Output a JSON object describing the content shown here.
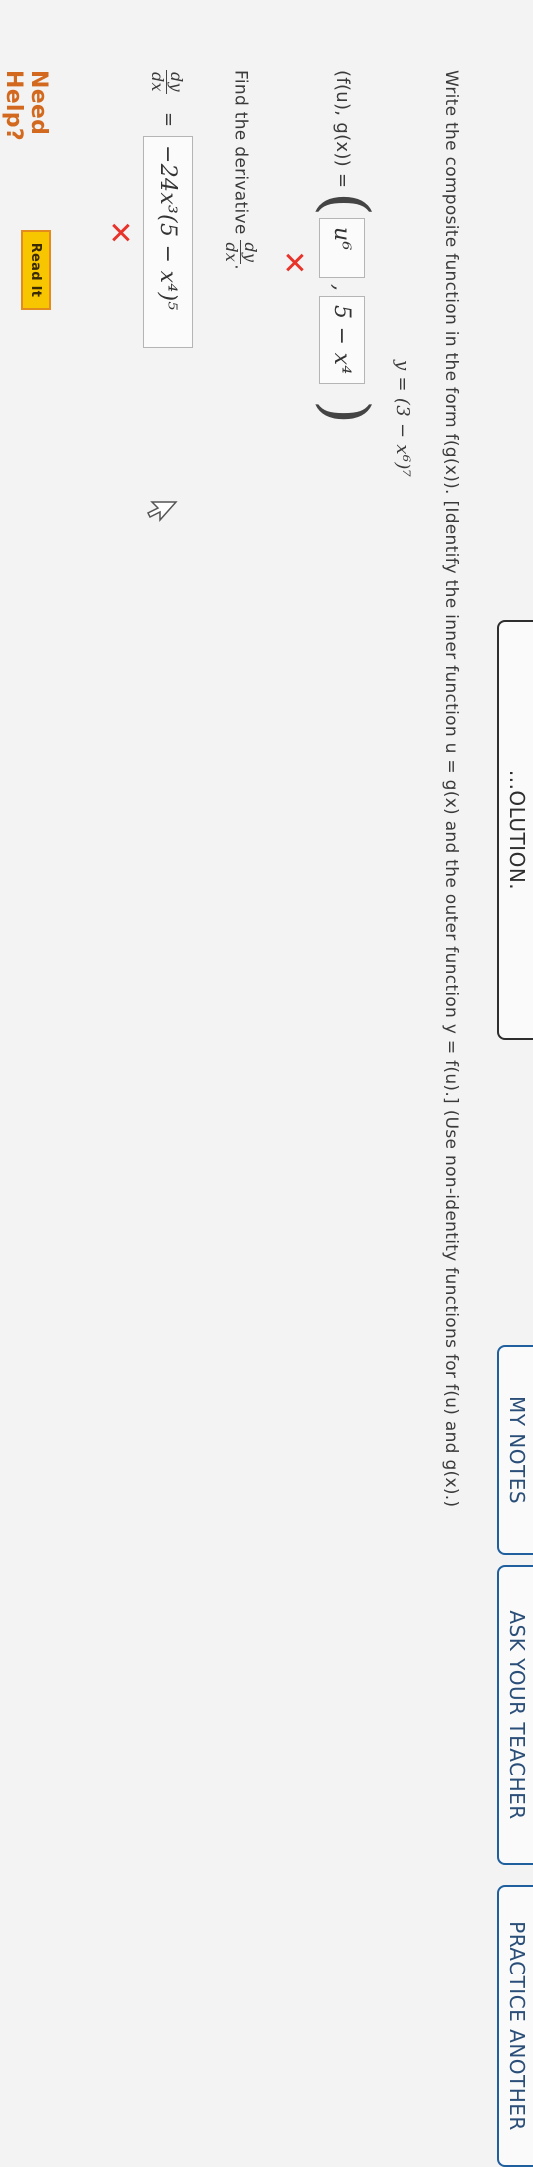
{
  "header": {
    "partial_title": "...OLUTION.",
    "my_notes_label": "MY NOTES",
    "ask_teacher_label": "ASK YOUR TEACHER",
    "practice_another_label": "PRACTICE ANOTHER"
  },
  "question": {
    "instruction": "Write the composite function in the form f(g(x)). [Identify the inner function u = g(x) and the outer function y = f(u).] (Use non-identity functions for f(u) and g(x).)",
    "function_expr": "y = (3 − x⁶)⁷",
    "pair_label": "(f(u), g(x)) =",
    "answer_fu": "u⁶",
    "answer_gx": "5 − x⁴",
    "answer_separator": ",",
    "derivative_prompt": "Find the derivative",
    "derivative_num": "dy",
    "derivative_den": "dx",
    "derivative_period": ".",
    "derivative_lhs_num": "dy",
    "derivative_lhs_den": "dx",
    "equals": "=",
    "derivative_answer": "−24x³(5 − x⁴)⁵",
    "answer1_status": "incorrect",
    "answer2_status": "incorrect"
  },
  "help": {
    "need_help_label": "Need Help?",
    "read_it_label": "Read It"
  },
  "colors": {
    "link_blue": "#1f5f9e",
    "wrong_red": "#e8332a",
    "help_orange": "#d2691e",
    "read_it_yellow": "#f7c600"
  },
  "icons": {
    "incorrect": "x-mark-icon",
    "pointer": "mouse-cursor-icon"
  }
}
